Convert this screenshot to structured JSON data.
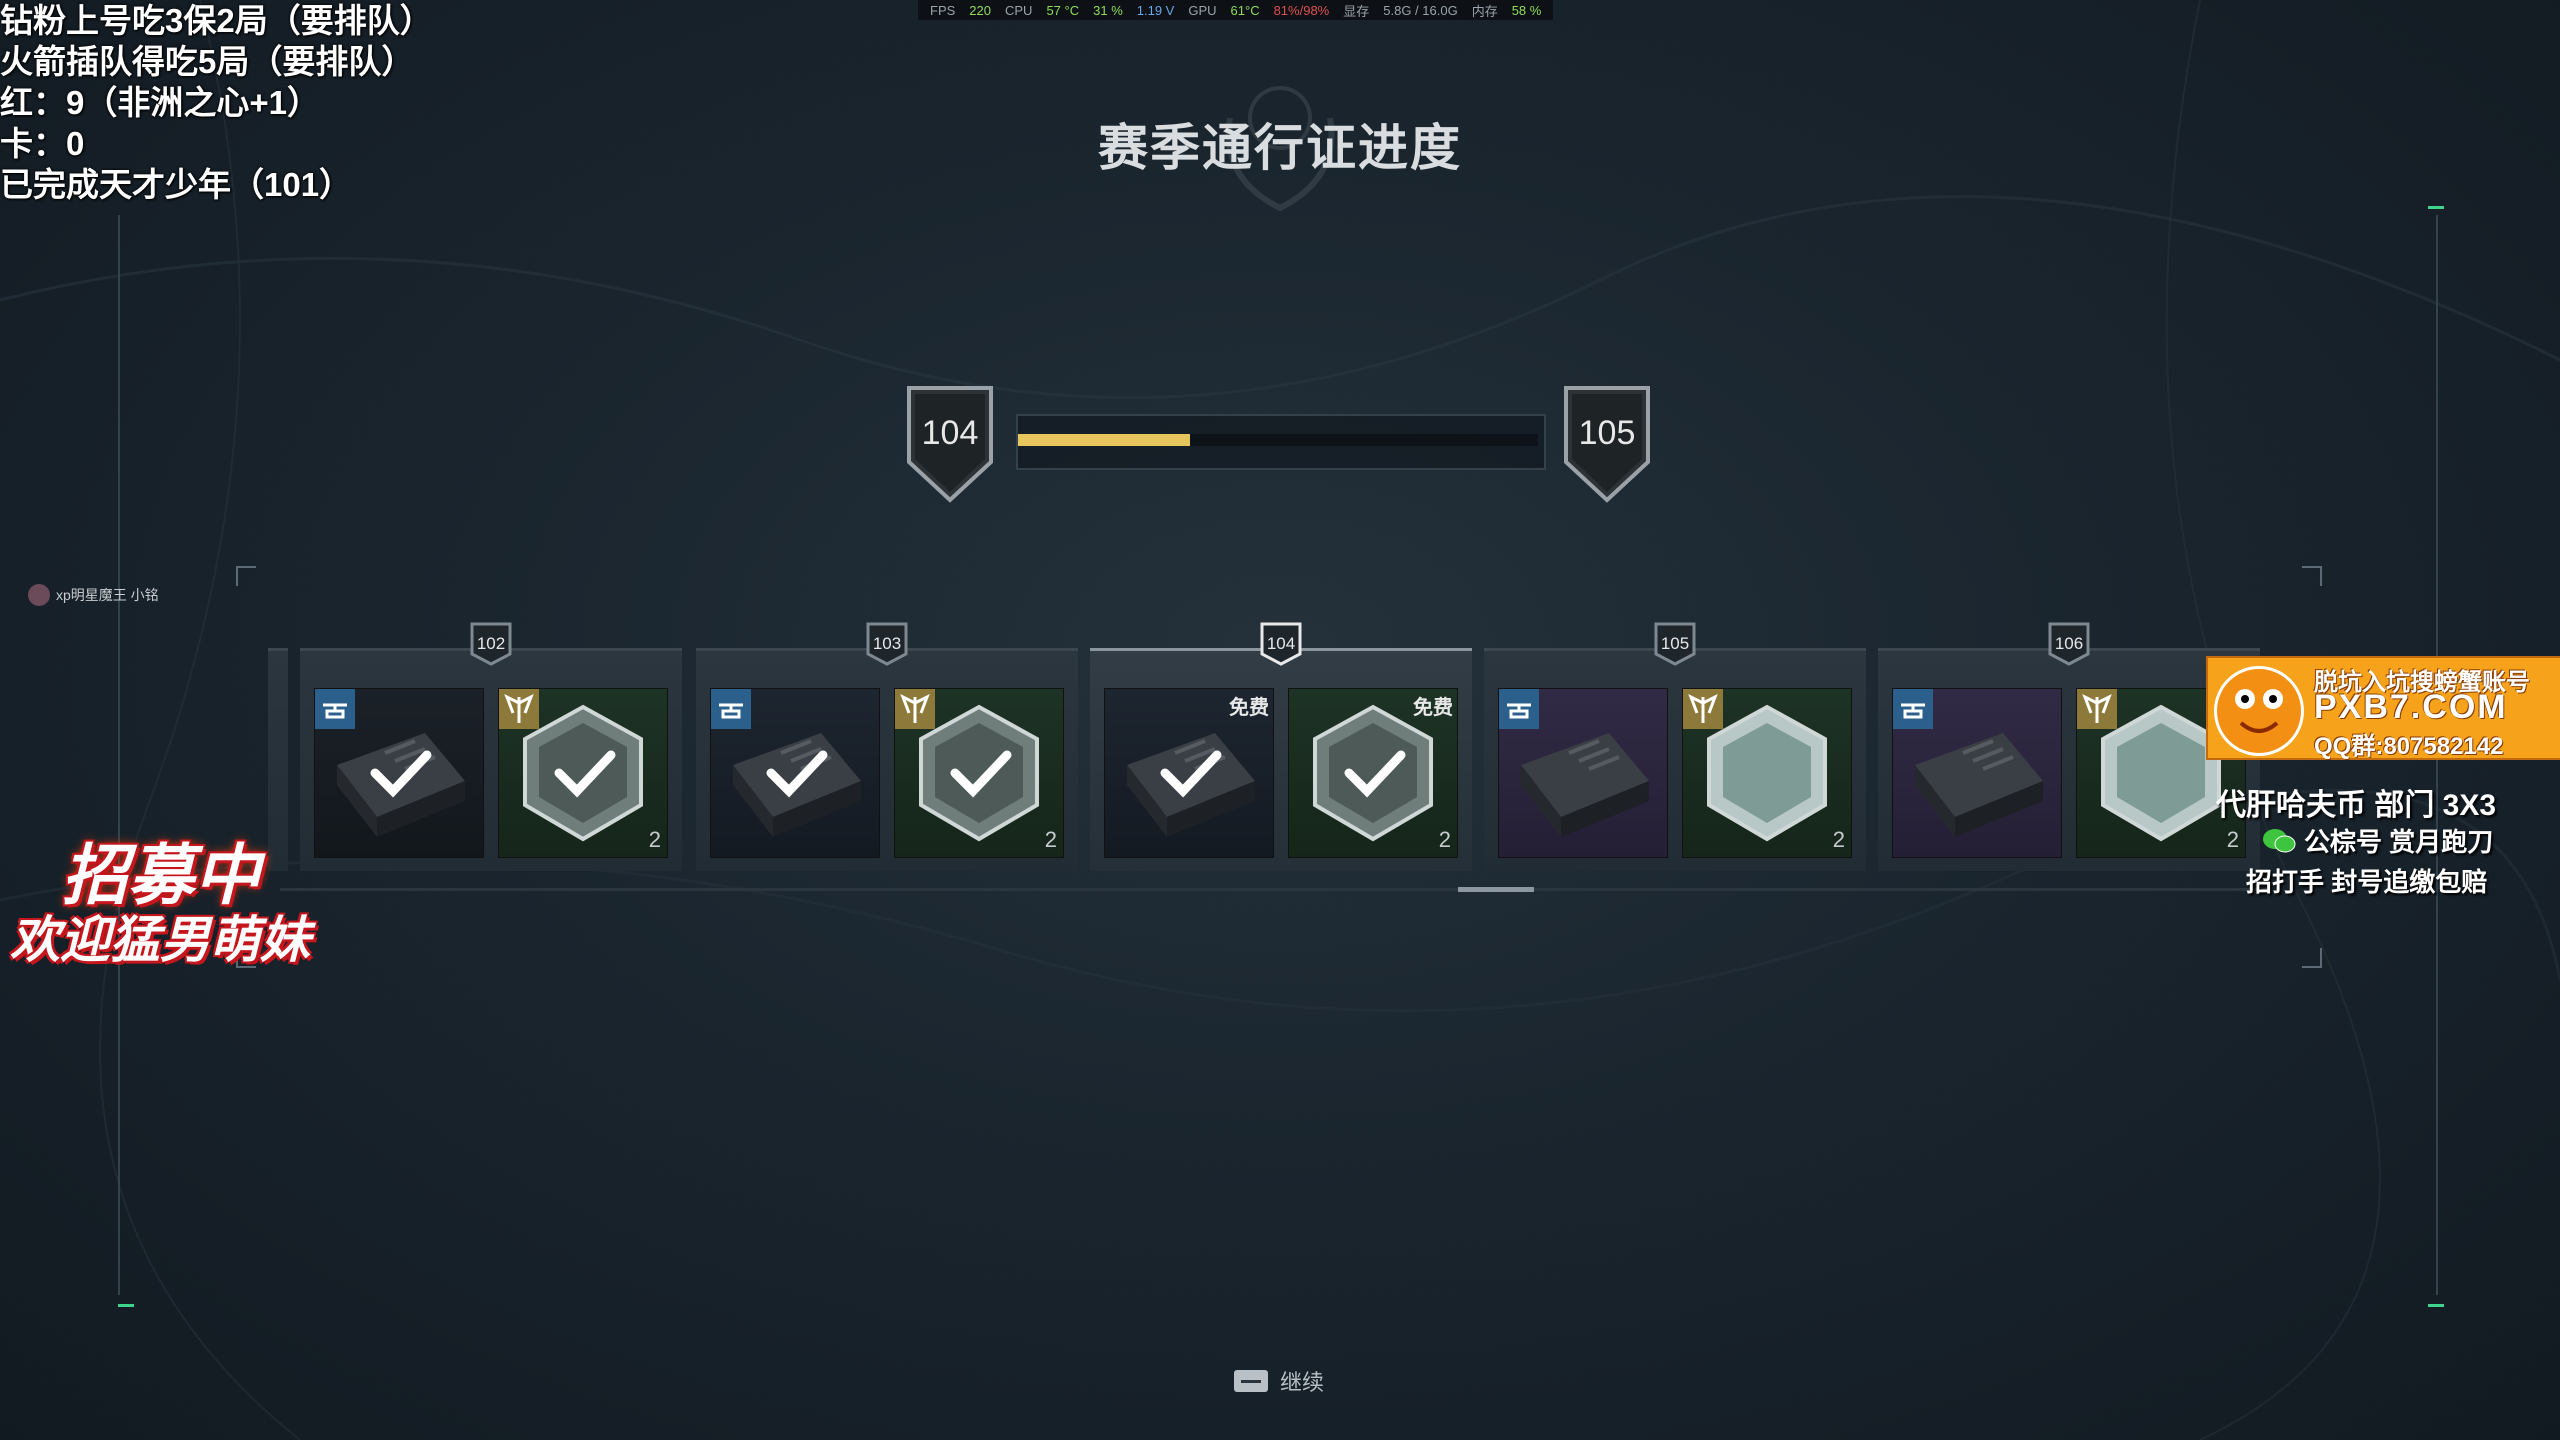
{
  "stats_bar": {
    "fps_label": "FPS",
    "fps_value": "220",
    "cpu_label": "CPU",
    "cpu_temp": "57 °C",
    "cpu_load": "31 %",
    "cpu_voltage": "1.19 V",
    "gpu_label": "GPU",
    "gpu_temp": "61°C",
    "gpu_load": "81%/98%",
    "vram_label": "显存",
    "vram_value": "5.8G / 16.0G",
    "ram_label": "内存",
    "ram_value": "58 %"
  },
  "overlay_notes": [
    "钻粉上号吃3保2局（要排队）",
    "火箭插队得吃5局（要排队）",
    "红：9（非洲之心+1）",
    "卡：0",
    "已完成天才少年（101）"
  ],
  "page_title": "赛季通行证进度",
  "progress": {
    "current_level": "104",
    "next_level": "105",
    "fill_fraction": 0.33,
    "fill_color": "#e5c55c"
  },
  "reward_levels": [
    {
      "level": "102",
      "active": false,
      "items": [
        {
          "type": "box",
          "tone": "dark",
          "badge": "helicopter-badge-icon",
          "claimed": true,
          "free_label": "",
          "count": ""
        },
        {
          "type": "emblem",
          "badge": "wing-badge-icon",
          "claimed": true,
          "free_label": "",
          "count": "2"
        }
      ]
    },
    {
      "level": "103",
      "active": false,
      "items": [
        {
          "type": "box",
          "tone": "blue",
          "badge": "helicopter-badge-icon",
          "claimed": true,
          "free_label": "",
          "count": ""
        },
        {
          "type": "emblem",
          "badge": "wing-badge-icon",
          "claimed": true,
          "free_label": "",
          "count": "2"
        }
      ]
    },
    {
      "level": "104",
      "active": true,
      "items": [
        {
          "type": "box",
          "tone": "blue",
          "badge": "",
          "claimed": true,
          "free_label": "免费",
          "count": ""
        },
        {
          "type": "emblem",
          "badge": "",
          "claimed": true,
          "free_label": "免费",
          "count": "2"
        }
      ]
    },
    {
      "level": "105",
      "active": false,
      "items": [
        {
          "type": "box",
          "tone": "purple",
          "badge": "helicopter-badge-icon",
          "claimed": false,
          "free_label": "",
          "count": ""
        },
        {
          "type": "emblem",
          "badge": "wing-badge-icon",
          "claimed": false,
          "free_label": "",
          "count": "2"
        }
      ]
    },
    {
      "level": "106",
      "active": false,
      "items": [
        {
          "type": "box",
          "tone": "purple",
          "badge": "helicopter-badge-icon",
          "claimed": false,
          "free_label": "",
          "count": ""
        },
        {
          "type": "emblem",
          "badge": "wing-badge-icon",
          "claimed": false,
          "free_label": "",
          "count": "2"
        }
      ]
    }
  ],
  "continue": {
    "key_icon": "spacebar-key-icon",
    "label": "继续"
  },
  "chat": {
    "username": "xp明星魔王 小铭"
  },
  "recruit_sticker": {
    "line1": "招募中",
    "line2": "欢迎猛男萌妹"
  },
  "ad": {
    "line1": "脱坑入坑搜螃蟹账号",
    "line2": "PXB7.COM",
    "line3": "QQ群:807582142",
    "line4": "代肝哈夫币 部门 3X3",
    "line5_icon": "wechat-icon",
    "line5": "公棕号 赏月跑刀",
    "line6": "招打手 封号追缴包赔"
  }
}
